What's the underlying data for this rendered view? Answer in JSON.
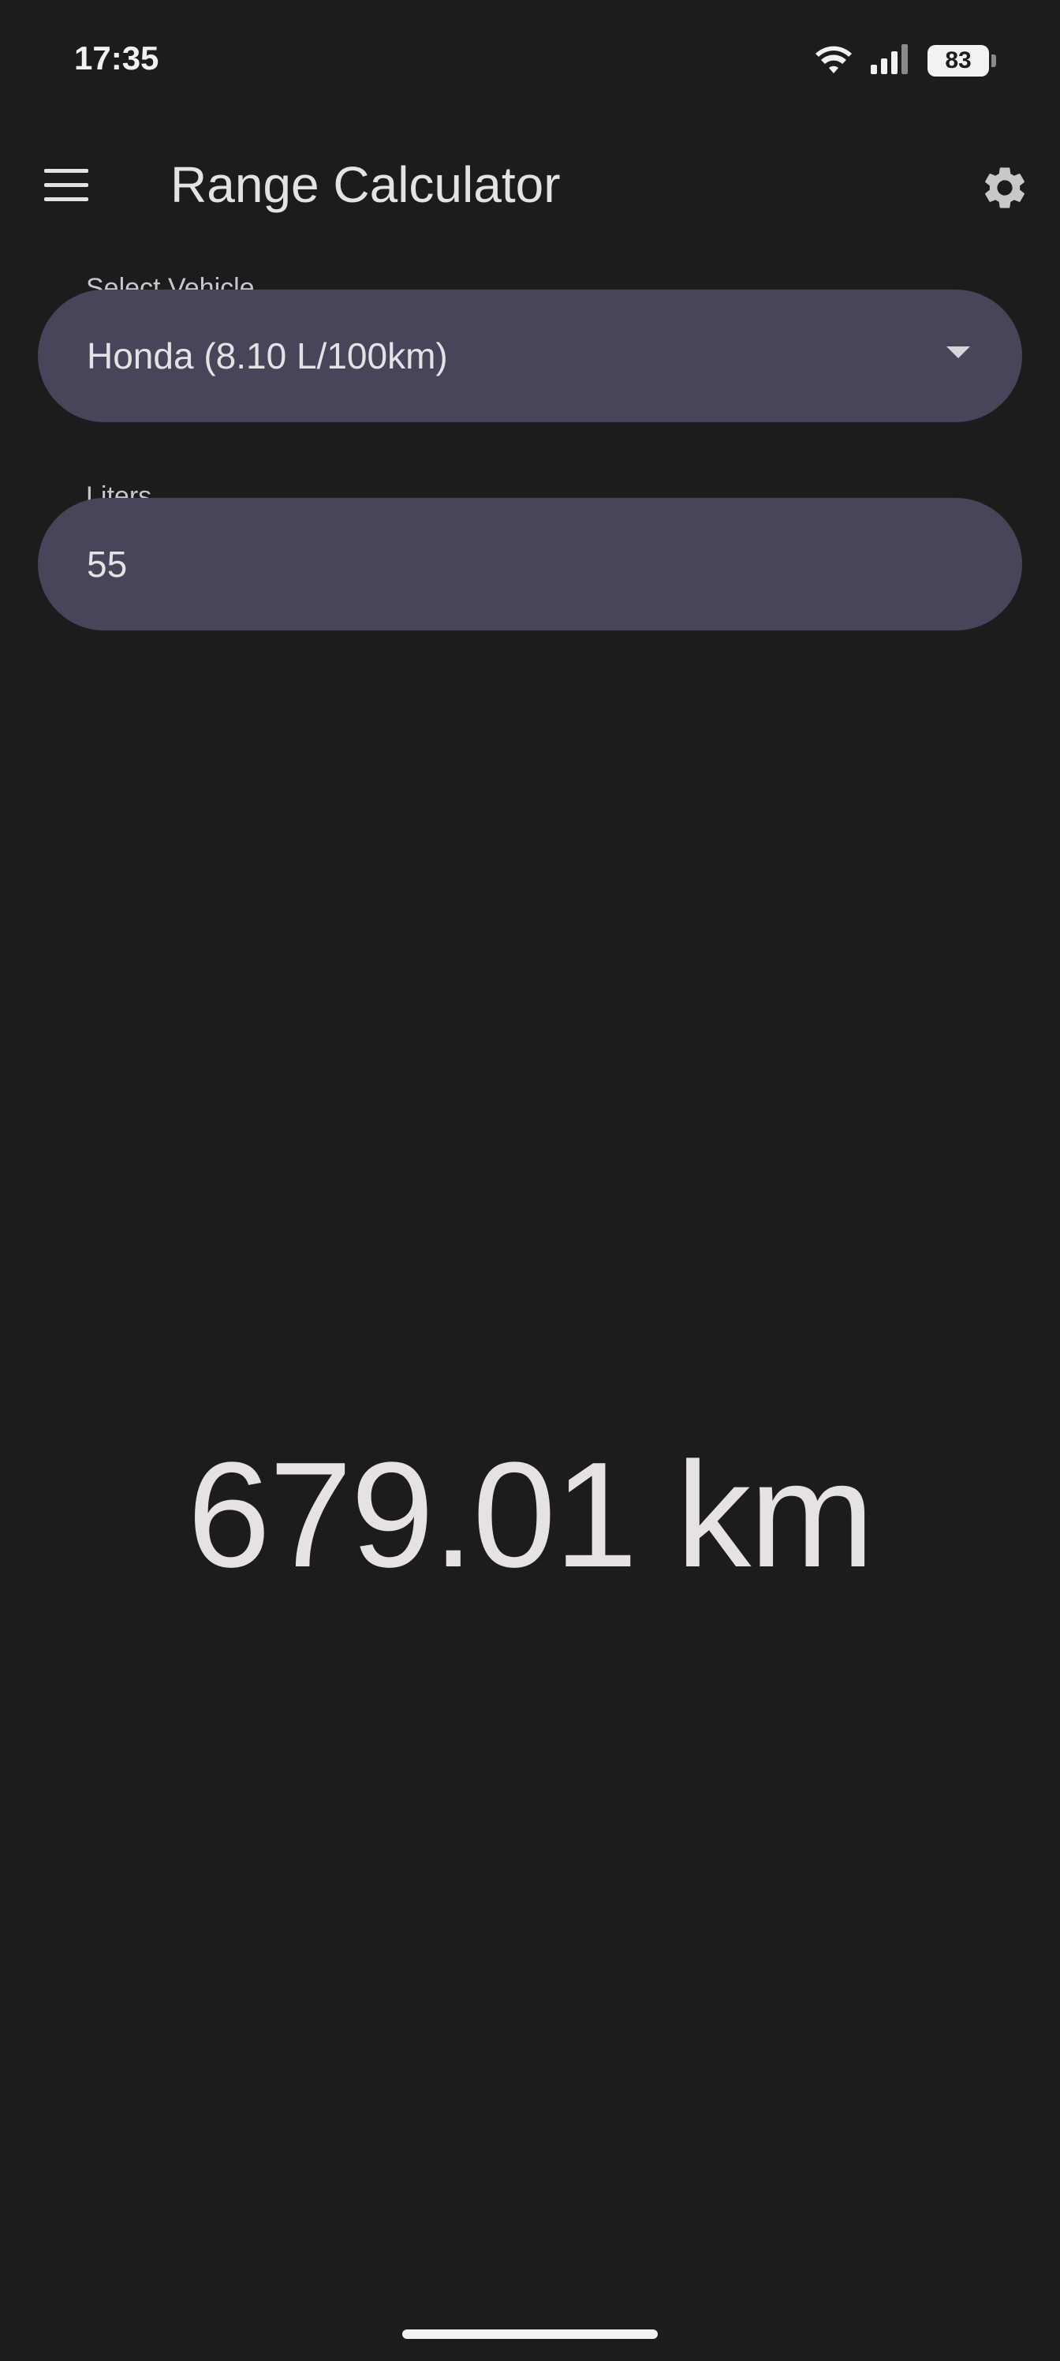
{
  "status_bar": {
    "time": "17:35",
    "battery_level": "83",
    "icons": [
      "wifi-icon",
      "cellular-signal-icon",
      "battery-icon"
    ]
  },
  "app_bar": {
    "title": "Range Calculator",
    "menu_icon": "menu-icon",
    "settings_icon": "gear-icon"
  },
  "vehicle_select": {
    "label": "Select Vehicle",
    "value": "Honda (8.10 L/100km)"
  },
  "liters_input": {
    "label": "Liters",
    "value": "55"
  },
  "result": {
    "text": "679.01 km"
  },
  "colors": {
    "background": "#1c1c1c",
    "field_background": "#48445a",
    "text": "#e6e1e5",
    "label": "#cac4d0"
  }
}
